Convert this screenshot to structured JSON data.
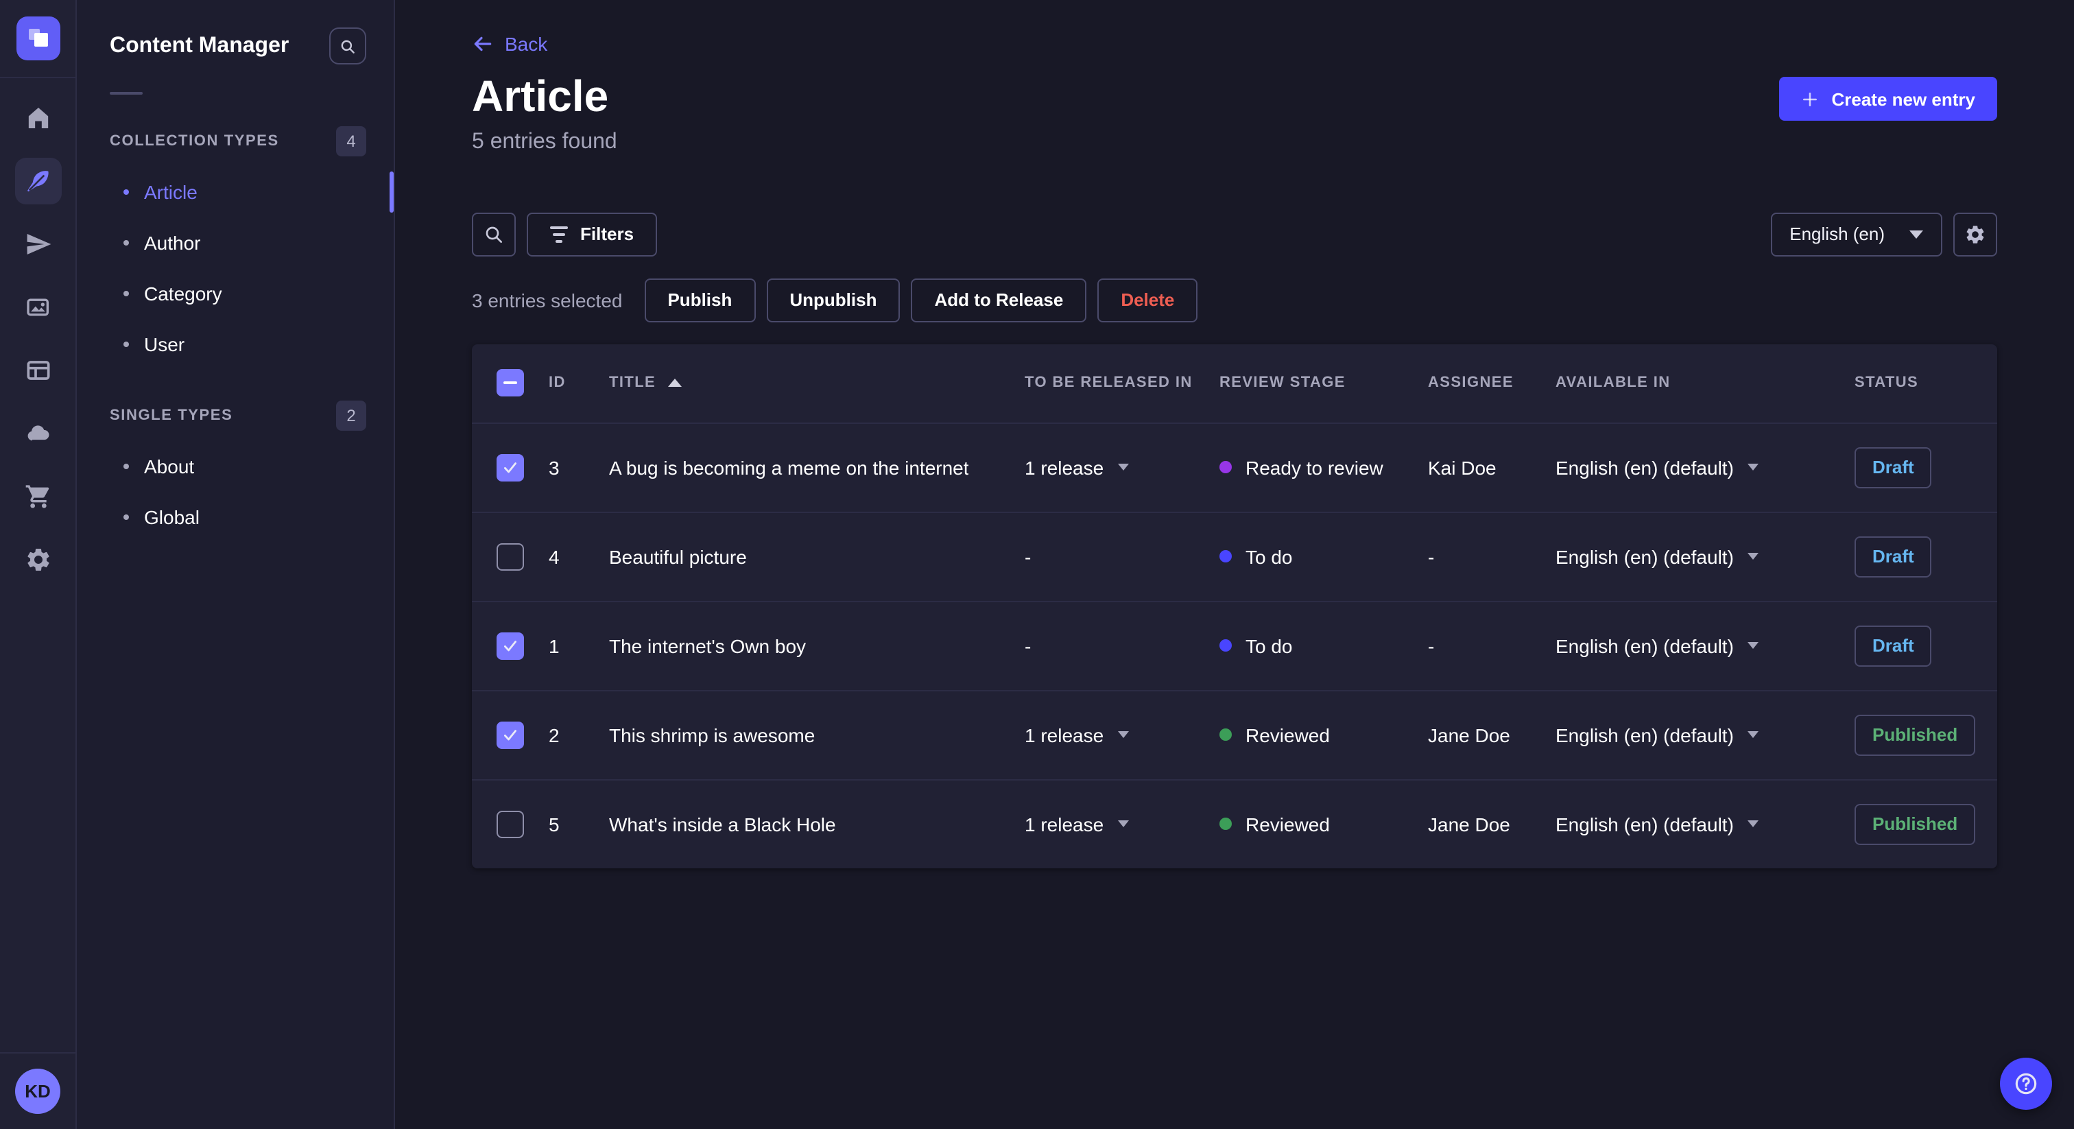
{
  "colors": {
    "accent": "#4945ff",
    "accent_light": "#7b79ff",
    "danger": "#ee5e52",
    "stage_colors": {
      "Ready to review": "#9736e8",
      "To do": "#4945ff",
      "Reviewed": "#3c9e58"
    },
    "status_colors": {
      "Draft": "#66b7f1",
      "Published": "#5cb176"
    }
  },
  "icon_rail": {
    "items": [
      "home",
      "content-manager",
      "releases",
      "media-library",
      "content-type-builder",
      "cloud",
      "marketplace",
      "settings"
    ],
    "active_item": "content-manager",
    "avatar_initials": "KD"
  },
  "subnav": {
    "title": "Content Manager",
    "sections": [
      {
        "label": "COLLECTION TYPES",
        "count": "4",
        "items": [
          {
            "label": "Article",
            "active": true
          },
          {
            "label": "Author"
          },
          {
            "label": "Category"
          },
          {
            "label": "User"
          }
        ]
      },
      {
        "label": "SINGLE TYPES",
        "count": "2",
        "items": [
          {
            "label": "About"
          },
          {
            "label": "Global"
          }
        ]
      }
    ]
  },
  "header": {
    "back_label": "Back",
    "title": "Article",
    "subtitle": "5 entries found",
    "create_button_label": "Create new entry"
  },
  "toolbar": {
    "filters_label": "Filters",
    "locale_value": "English (en)"
  },
  "selection": {
    "text": "3 entries selected",
    "actions": {
      "publish": "Publish",
      "unpublish": "Unpublish",
      "add_to_release": "Add to Release",
      "delete": "Delete"
    }
  },
  "table": {
    "columns": [
      "ID",
      "TITLE",
      "TO BE RELEASED IN",
      "REVIEW STAGE",
      "ASSIGNEE",
      "AVAILABLE IN",
      "STATUS"
    ],
    "rows": [
      {
        "checked": true,
        "id": "3",
        "title": "A bug is becoming a meme on the internet",
        "to_be_released_in": "1 release",
        "review_stage": "Ready to review",
        "assignee": "Kai Doe",
        "available_in": "English (en) (default)",
        "status": "Draft"
      },
      {
        "checked": false,
        "id": "4",
        "title": "Beautiful picture",
        "to_be_released_in": "-",
        "review_stage": "To do",
        "assignee": "-",
        "available_in": "English (en) (default)",
        "status": "Draft"
      },
      {
        "checked": true,
        "id": "1",
        "title": "The internet's Own boy",
        "to_be_released_in": "-",
        "review_stage": "To do",
        "assignee": "-",
        "available_in": "English (en) (default)",
        "status": "Draft"
      },
      {
        "checked": true,
        "id": "2",
        "title": "This shrimp is awesome",
        "to_be_released_in": "1 release",
        "review_stage": "Reviewed",
        "assignee": "Jane Doe",
        "available_in": "English (en) (default)",
        "status": "Published"
      },
      {
        "checked": false,
        "id": "5",
        "title": "What's inside a Black Hole",
        "to_be_released_in": "1 release",
        "review_stage": "Reviewed",
        "assignee": "Jane Doe",
        "available_in": "English (en) (default)",
        "status": "Published"
      }
    ]
  }
}
